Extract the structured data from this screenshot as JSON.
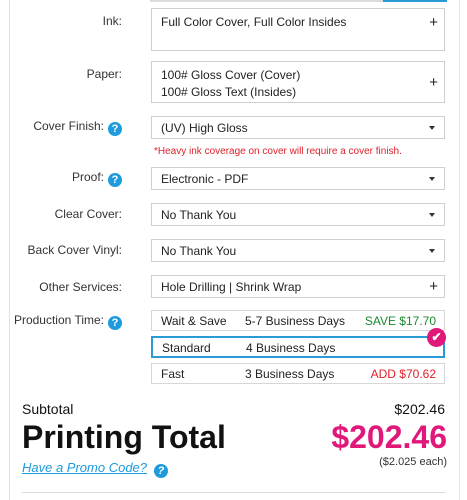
{
  "form": {
    "ink": {
      "label": "Ink:",
      "value": "Full Color Cover, Full Color Insides"
    },
    "paper": {
      "label": "Paper:",
      "line1": "100# Gloss Cover (Cover)",
      "line2": "100# Gloss Text (Insides)"
    },
    "cover_finish": {
      "label": "Cover Finish:",
      "value": "(UV) High Gloss",
      "warning": "*Heavy ink coverage on cover will require a cover finish."
    },
    "proof": {
      "label": "Proof:",
      "value": "Electronic - PDF"
    },
    "clear_cover": {
      "label": "Clear Cover:",
      "value": "No Thank You"
    },
    "back_cover_vinyl": {
      "label": "Back Cover Vinyl:",
      "value": "No Thank You"
    },
    "other_services": {
      "label": "Other Services:",
      "value": "Hole Drilling | Shrink Wrap"
    },
    "production_time": {
      "label": "Production Time:",
      "options": [
        {
          "name": "Wait & Save",
          "days": "5-7 Business Days",
          "price": "SAVE $17.70"
        },
        {
          "name": "Standard",
          "days": "4 Business Days",
          "price": ""
        },
        {
          "name": "Fast",
          "days": "3 Business Days",
          "price": "ADD $70.62"
        }
      ],
      "selected": "Standard"
    }
  },
  "icons": {
    "help": "question-mark-icon",
    "expand": "plus-icon",
    "dropdown": "caret-down-icon",
    "selected": "checkmark-icon"
  },
  "summary": {
    "subtotal_label": "Subtotal",
    "subtotal_value": "$202.46",
    "total_label": "Printing Total",
    "total_value": "$202.46",
    "per_each": "($2.025 each)",
    "promo_link": "Have a Promo Code?"
  },
  "colors": {
    "accent": "#1e9bdc",
    "brand_pink": "#e0187a",
    "warning": "#e0202a",
    "save_green": "#1b8a2e"
  }
}
